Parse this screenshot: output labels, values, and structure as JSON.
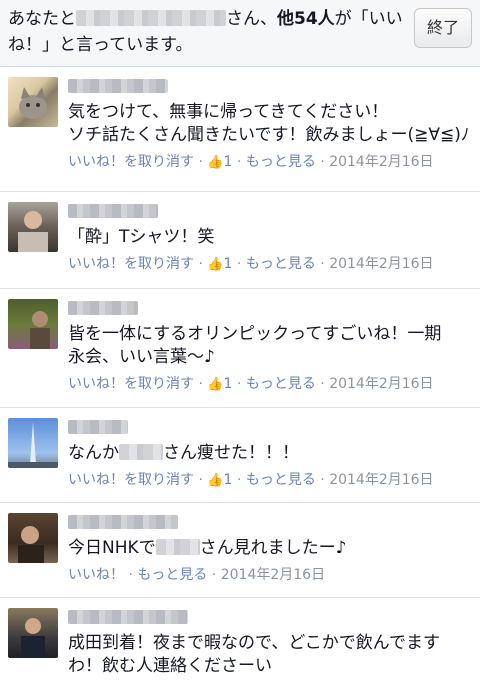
{
  "header": {
    "pre": "あなたと",
    "post": "さん、",
    "bold": "他54人",
    "tail": "が「いいね！」と言っています。",
    "done_label": "終了"
  },
  "comments": [
    {
      "text": "気をつけて、無事に帰ってきてください！\nソチ話たくさん聞きたいです！飲みましょー(≧∀≦)ﾉ",
      "action": "いいね！を取り消す",
      "like_count": "1",
      "more": "もっと見る",
      "date": "2014年2月16日"
    },
    {
      "text": "「酔」Tシャツ！笑",
      "action": "いいね！を取り消す",
      "like_count": "1",
      "more": "もっと見る",
      "date": "2014年2月16日"
    },
    {
      "text": "皆を一体にするオリンピックってすごいね！一期\n永会、いい言葉〜♪",
      "action": "いいね！を取り消す",
      "like_count": "1",
      "more": "もっと見る",
      "date": "2014年2月16日"
    },
    {
      "text_pre": "なんか",
      "text_post": "さん痩せた！！！",
      "action": "いいね！を取り消す",
      "like_count": "1",
      "more": "もっと見る",
      "date": "2014年2月16日"
    },
    {
      "text_pre": "今日NHKで",
      "text_post": "さん見れましたー♪",
      "action": "いいね！",
      "more": "もっと見る",
      "date": "2014年2月16日"
    },
    {
      "text": "成田到着！夜まで暇なので、どこかで飲んでます\nわ！飲む人連絡くださーい"
    }
  ]
}
